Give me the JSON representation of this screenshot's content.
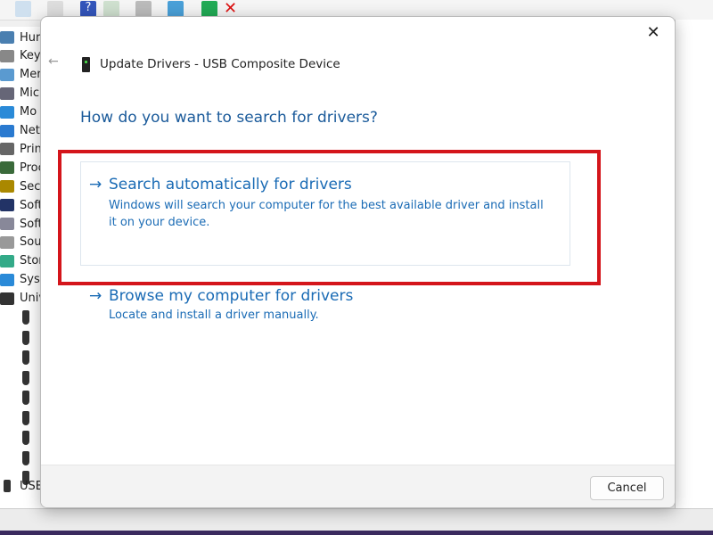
{
  "background": {
    "toolbar_icons": [
      "properties-icon",
      "document-icon",
      "help-icon",
      "view-icon",
      "update-driver-icon",
      "scan-hardware-icon",
      "enable-device-icon",
      "uninstall-icon"
    ],
    "tree_items": [
      "Hur",
      "Key",
      "Mer",
      "Mic",
      "Mo",
      "Net",
      "Prin",
      "Proc",
      "Sec",
      "Soft",
      "Soft",
      "Sou",
      "Stor",
      "Syst",
      "Univ"
    ],
    "usb_last": "USB"
  },
  "dialog": {
    "title": "Update Drivers - USB Composite Device",
    "heading": "How do you want to search for drivers?",
    "options": [
      {
        "title": "Search automatically for drivers",
        "description": "Windows will search your computer for the best available driver and install it on your device."
      },
      {
        "title": "Browse my computer for drivers",
        "description": "Locate and install a driver manually."
      }
    ],
    "arrow": "→",
    "close": "✕",
    "back": "←",
    "cancel_label": "Cancel",
    "highlight_color": "#d4151b",
    "accent_color": "#1a6bb5"
  }
}
